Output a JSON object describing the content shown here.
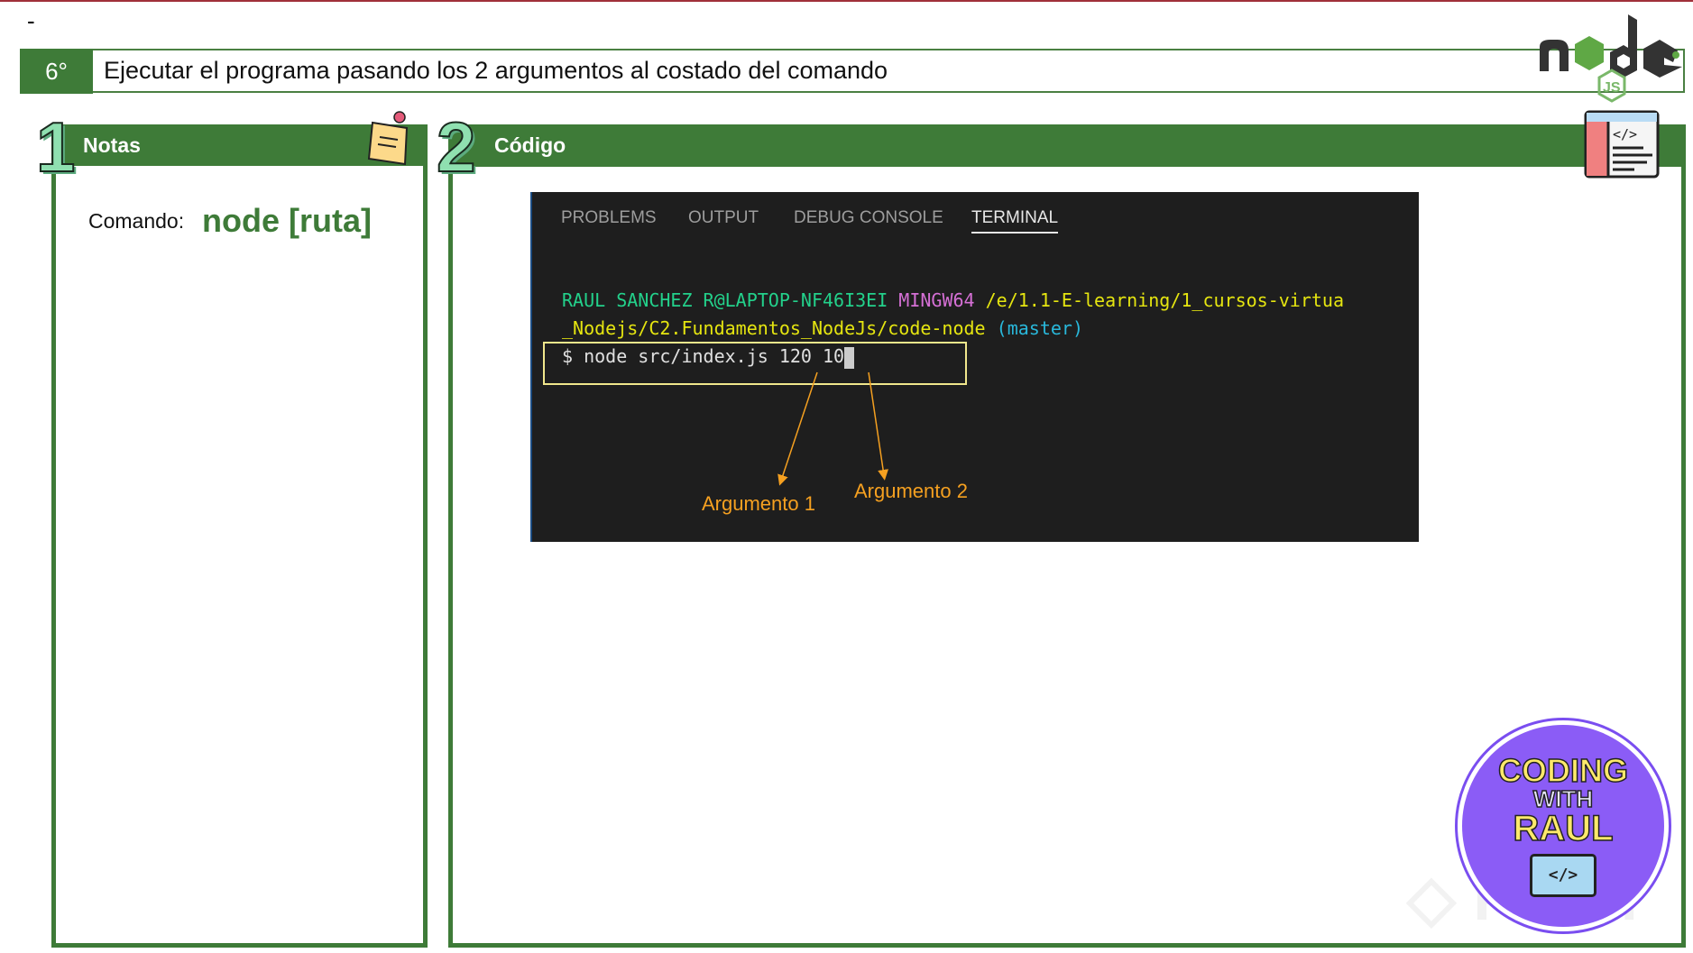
{
  "header": {
    "dash": "-",
    "step": "6°",
    "title": "Ejecutar el programa pasando los 2 argumentos al costado del comando"
  },
  "notes": {
    "number": "1",
    "title": "Notas",
    "command_label": "Comando:",
    "command_value": "node [ruta]"
  },
  "code": {
    "number": "2",
    "title": "Código"
  },
  "terminal": {
    "tabs": [
      "PROBLEMS",
      "OUTPUT",
      "DEBUG CONSOLE",
      "TERMINAL"
    ],
    "active_tab": "TERMINAL",
    "user": "RAUL SANCHEZ R@LAPTOP-NF46I3EI",
    "env": "MINGW64",
    "path1": "/e/1.1-E-learning/1_cursos-virtua",
    "path2": "_Nodejs/C2.Fundamentos_NodeJs/code-node",
    "branch": "(master)",
    "command": "$ node src/index.js 120 10",
    "annotations": [
      "Argumento 1",
      "Argumento 2"
    ]
  },
  "logos": {
    "node": "node JS",
    "brand": "CODING WITH RAUL SR",
    "watermark": "Platzi"
  },
  "colors": {
    "green": "#3e7b38",
    "accent": "#f5a020",
    "highlight": "#f0e68c"
  }
}
